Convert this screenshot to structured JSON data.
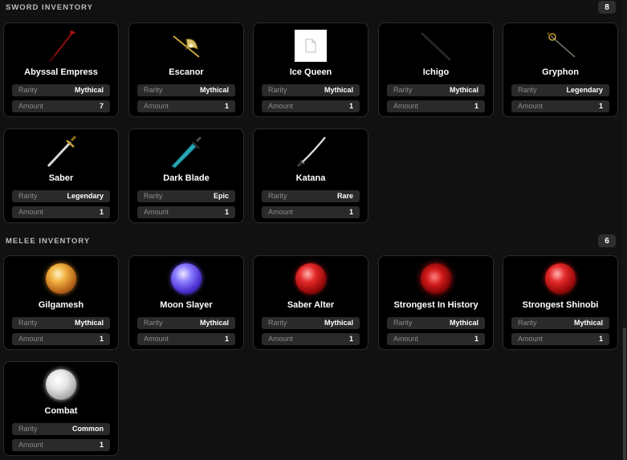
{
  "sword_inventory": {
    "title": "SWORD INVENTORY",
    "count": "8",
    "items": [
      {
        "name": "Abyssal Empress",
        "rarity_label": "Rarity",
        "rarity": "Mythical",
        "amount_label": "Amount",
        "amount": "7",
        "icon": "crimson-scythe-icon"
      },
      {
        "name": "Escanor",
        "rarity_label": "Rarity",
        "rarity": "Mythical",
        "amount_label": "Amount",
        "amount": "1",
        "icon": "golden-axe-icon"
      },
      {
        "name": "Ice Queen",
        "rarity_label": "Rarity",
        "rarity": "Mythical",
        "amount_label": "Amount",
        "amount": "1",
        "icon": "missing-image-icon"
      },
      {
        "name": "Ichigo",
        "rarity_label": "Rarity",
        "rarity": "Mythical",
        "amount_label": "Amount",
        "amount": "1",
        "icon": "black-sword-icon"
      },
      {
        "name": "Gryphon",
        "rarity_label": "Rarity",
        "rarity": "Legendary",
        "amount_label": "Amount",
        "amount": "1",
        "icon": "rapier-icon"
      },
      {
        "name": "Saber",
        "rarity_label": "Rarity",
        "rarity": "Legendary",
        "amount_label": "Amount",
        "amount": "1",
        "icon": "gold-hilt-sword-icon"
      },
      {
        "name": "Dark Blade",
        "rarity_label": "Rarity",
        "rarity": "Epic",
        "amount_label": "Amount",
        "amount": "1",
        "icon": "teal-blade-icon"
      },
      {
        "name": "Katana",
        "rarity_label": "Rarity",
        "rarity": "Rare",
        "amount_label": "Amount",
        "amount": "1",
        "icon": "katana-icon"
      }
    ]
  },
  "melee_inventory": {
    "title": "MELEE INVENTORY",
    "count": "6",
    "items": [
      {
        "name": "Gilgamesh",
        "rarity_label": "Rarity",
        "rarity": "Mythical",
        "amount_label": "Amount",
        "amount": "1",
        "icon": "gold-orb-icon"
      },
      {
        "name": "Moon Slayer",
        "rarity_label": "Rarity",
        "rarity": "Mythical",
        "amount_label": "Amount",
        "amount": "1",
        "icon": "purple-orb-icon"
      },
      {
        "name": "Saber Alter",
        "rarity_label": "Rarity",
        "rarity": "Mythical",
        "amount_label": "Amount",
        "amount": "1",
        "icon": "red-orb-icon"
      },
      {
        "name": "Strongest In History",
        "rarity_label": "Rarity",
        "rarity": "Mythical",
        "amount_label": "Amount",
        "amount": "1",
        "icon": "red-spiral-orb-icon"
      },
      {
        "name": "Strongest Shinobi",
        "rarity_label": "Rarity",
        "rarity": "Mythical",
        "amount_label": "Amount",
        "amount": "1",
        "icon": "red-swirl-orb-icon"
      },
      {
        "name": "Combat",
        "rarity_label": "Rarity",
        "rarity": "Common",
        "amount_label": "Amount",
        "amount": "1",
        "icon": "white-orb-icon"
      }
    ]
  },
  "colors": {
    "background": "#111111",
    "card_background": "#000000",
    "card_border": "#2b2b2b",
    "row_background": "#2a2a2a",
    "label_text": "#8a8a8a"
  }
}
